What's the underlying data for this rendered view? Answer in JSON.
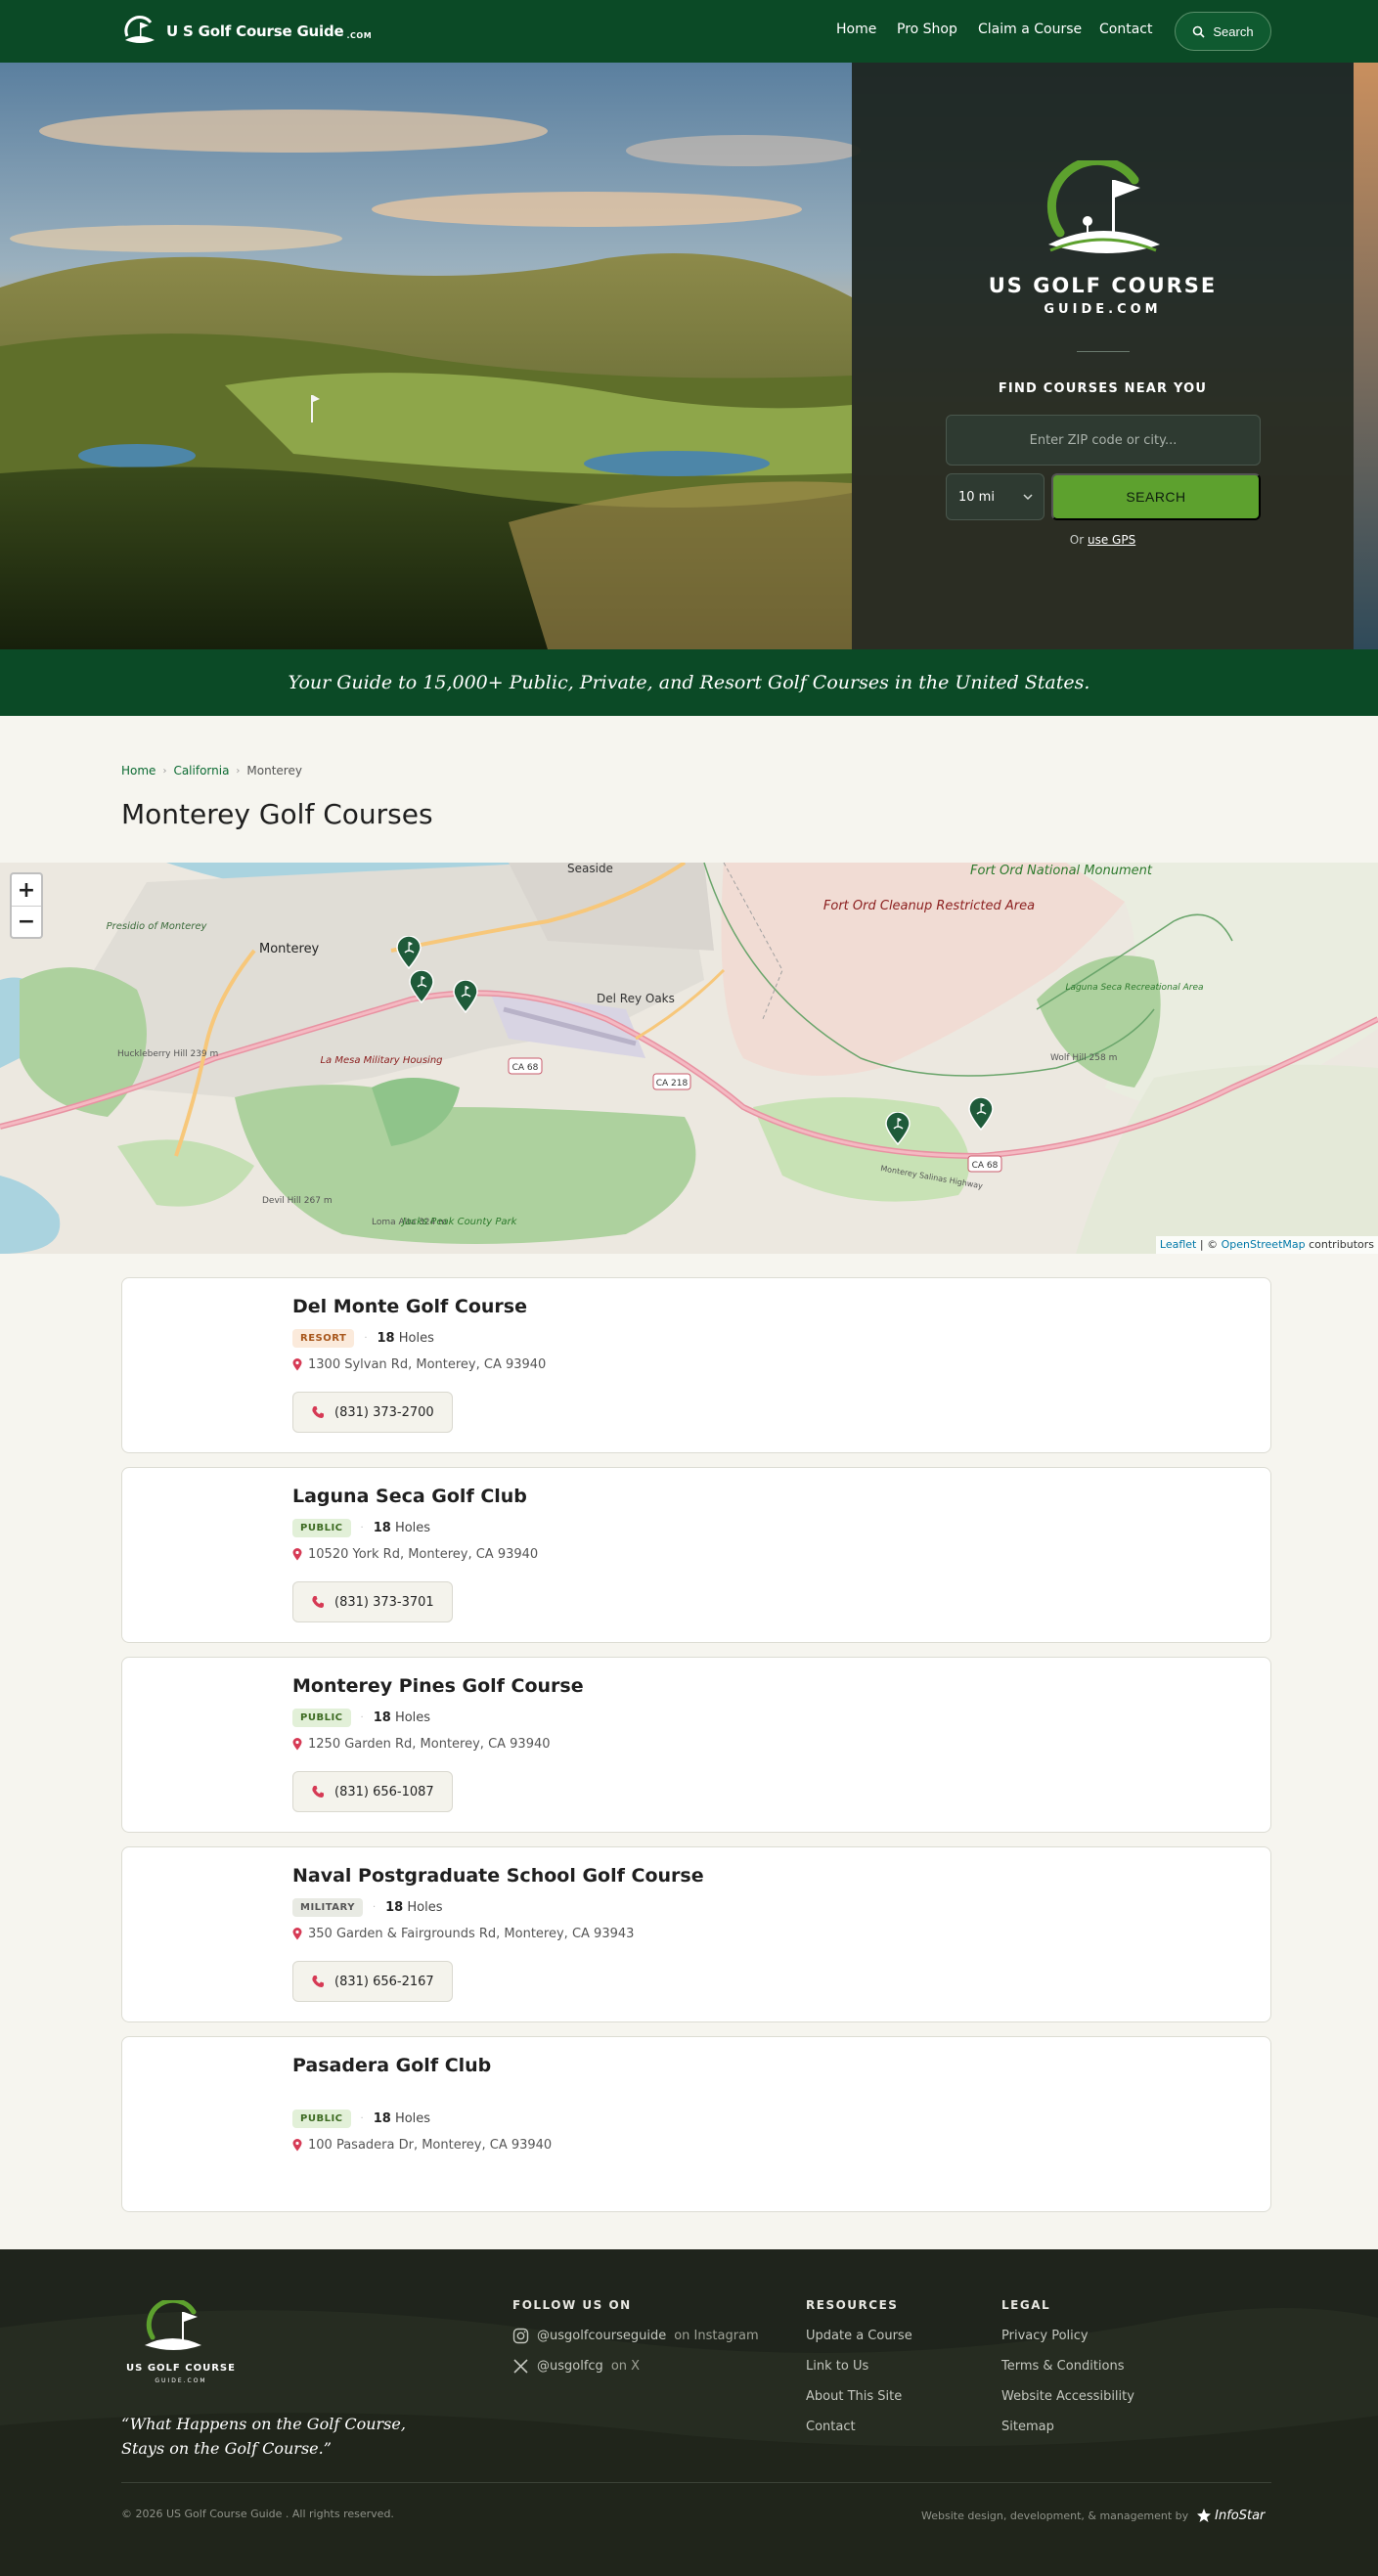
{
  "nav": {
    "brand": "U S Golf Course Guide",
    "brand_suffix": ".COM",
    "links": [
      "Home",
      "Pro Shop",
      "Claim a Course",
      "Contact"
    ],
    "search_label": "Search"
  },
  "hero": {
    "logo_line1": "US GOLF COURSE",
    "logo_line2": "GUIDE.COM",
    "find_heading": "FIND COURSES NEAR YOU",
    "zip_placeholder": "Enter ZIP code or city...",
    "radius": "10 mi",
    "search_button": "SEARCH",
    "gps_prefix": "Or",
    "gps_link": "use GPS"
  },
  "tagline": "Your Guide to 15,000+ Public, Private, and Resort Golf Courses in the United States.",
  "breadcrumb": [
    "Home",
    "California",
    "Monterey"
  ],
  "page_title": "Monterey Golf Courses",
  "map": {
    "labels": [
      "Seaside",
      "Fort Ord Cleanup Restricted Area",
      "Fort Ord National Monument",
      "Presidio of Monterey",
      "Monterey",
      "Del Rey Oaks",
      "Huckleberry Hill 239 m",
      "La Mesa Military Housing",
      "Laguna Seca Recreational Area",
      "Wolf Hill 258 m",
      "Devil Hill 267 m",
      "Loma Alta 324 m",
      "Jacks Peak County Park",
      "CA 68",
      "CA 218",
      "Monterey Salinas Highway"
    ],
    "zoom_in": "+",
    "zoom_out": "−",
    "attribution_leaflet": "Leaflet",
    "attribution_sep": " | © ",
    "attribution_osm": "OpenStreetMap",
    "attribution_tail": " contributors"
  },
  "courses": [
    {
      "name": "Del Monte Golf Course",
      "type": "RESORT",
      "holes": "18",
      "holes_label": "Holes",
      "address": "1300 Sylvan Rd, Monterey, CA 93940",
      "phone": "(831) 373-2700"
    },
    {
      "name": "Laguna Seca Golf Club",
      "type": "PUBLIC",
      "holes": "18",
      "holes_label": "Holes",
      "address": "10520 York Rd, Monterey, CA 93940",
      "phone": "(831) 373-3701"
    },
    {
      "name": "Monterey Pines Golf Course",
      "type": "PUBLIC",
      "holes": "18",
      "holes_label": "Holes",
      "address": "1250 Garden Rd, Monterey, CA 93940",
      "phone": "(831) 656-1087"
    },
    {
      "name": "Naval Postgraduate School Golf Course",
      "type": "MILITARY",
      "holes": "18",
      "holes_label": "Holes",
      "address": "350 Garden & Fairgrounds Rd, Monterey, CA 93943",
      "phone": "(831) 656-2167"
    },
    {
      "name": "Pasadera Golf Club",
      "type": "PUBLIC",
      "holes": "18",
      "holes_label": "Holes",
      "address": "100 Pasadera Dr, Monterey, CA 93940",
      "phone": ""
    }
  ],
  "footer": {
    "logo_line1": "US GOLF COURSE",
    "logo_line2": "GUIDE.COM",
    "quote": "“What Happens on the Golf Course, Stays on the Golf Course.”",
    "follow_title": "FOLLOW US ON",
    "instagram_handle": "@usgolfcourseguide",
    "instagram_suffix": "on Instagram",
    "x_handle": "@usgolfcg",
    "x_suffix": "on X",
    "resources_title": "RESOURCES",
    "resources": [
      "Update a Course",
      "Link to Us",
      "About This Site",
      "Contact"
    ],
    "legal_title": "LEGAL",
    "legal": [
      "Privacy Policy",
      "Terms & Conditions",
      "Website Accessibility",
      "Sitemap"
    ],
    "copyright": "© 2026 US Golf Course Guide . All rights reserved.",
    "credit": "Website design, development, & management by",
    "credit_brand": "InfoStar"
  },
  "colors": {
    "brand_green": "#0b4a26",
    "accent_green": "#5da12e",
    "pin_red": "#d63a55",
    "badge_resort": "#a8571c",
    "badge_public": "#3d6b22"
  },
  "icons": [
    "search-icon",
    "chevron-down-icon",
    "map-pin-icon",
    "phone-icon",
    "instagram-icon",
    "x-icon",
    "infostar-star-icon"
  ]
}
